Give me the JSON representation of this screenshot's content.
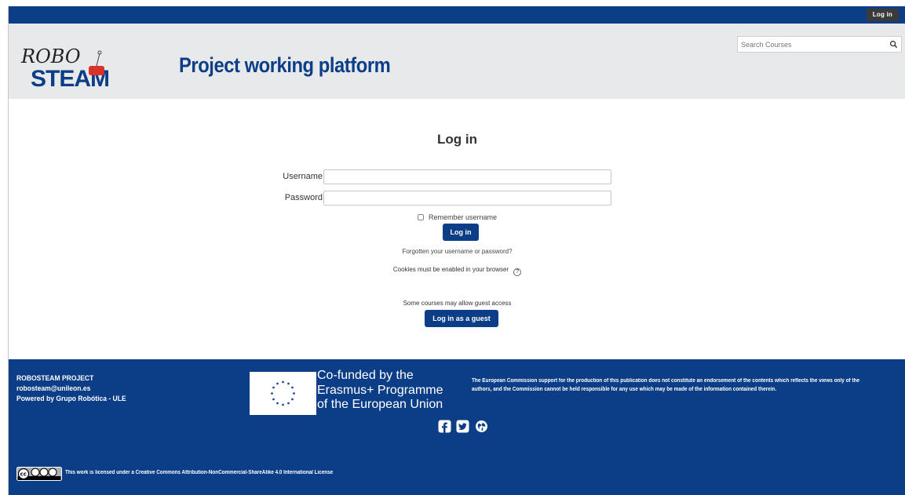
{
  "topbar": {
    "login_label": "Log in"
  },
  "header": {
    "site_title": "Project working platform",
    "search_placeholder": "Search Courses",
    "logo_text_top": "ROBO",
    "logo_text_bottom": "STEAM"
  },
  "login": {
    "title": "Log in",
    "username_label": "Username",
    "username_value": "",
    "password_label": "Password",
    "password_value": "",
    "remember_label": "Remember username",
    "submit_label": "Log in",
    "forgot_link": "Forgotten your username or password?",
    "cookies_note": "Cookies must be enabled in your browser",
    "guest_note": "Some courses may allow guest access",
    "guest_button": "Log in as a guest"
  },
  "footer": {
    "contact": [
      "ROBOSTEAM PROJECT",
      "robosteam@unileon.es",
      "Powered by Grupo Robótica - ULE"
    ],
    "eu_text": [
      "Co-funded by the",
      "Erasmus+ Programme",
      "of the European Union"
    ],
    "disclaimer": "The European Commission support for the production of this publication does not constitute an endorsement of the contents which reflects the views only of the authors, and the Commission cannot be held responsible for any use which may be made of the information contained therein.",
    "license": "This work is licensed under a Creative Commons Attribution-NonCommercial-ShareAlike 4.0 International License"
  },
  "colors": {
    "brand_blue": "#0c3e87",
    "header_bg": "#e8e9eb",
    "dark_button": "#3b3b3b"
  }
}
